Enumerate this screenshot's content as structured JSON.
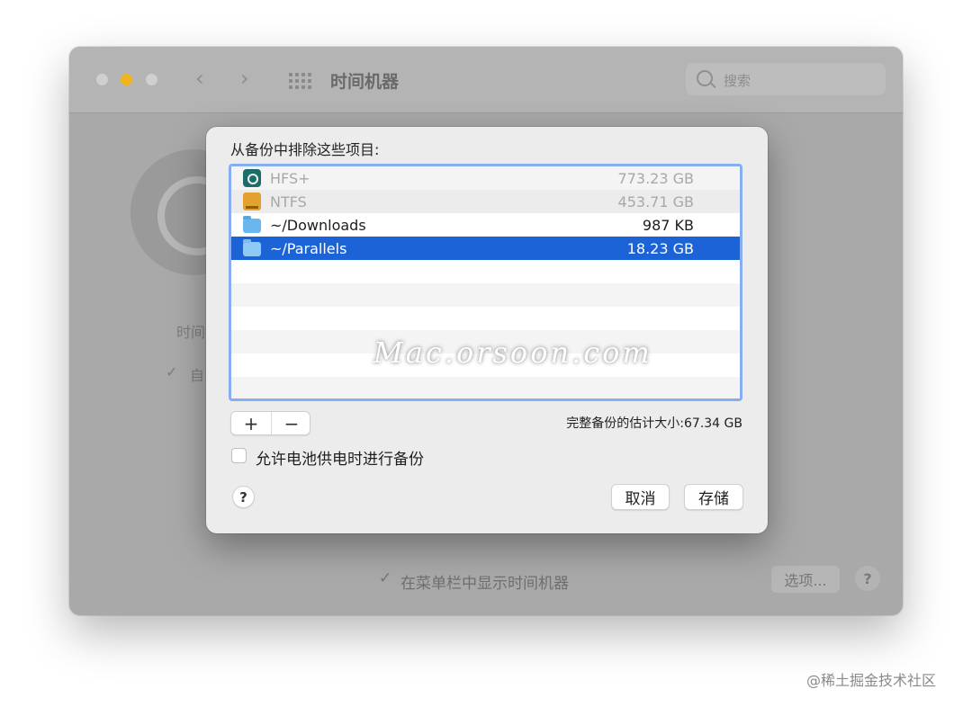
{
  "window": {
    "title": "时间机器",
    "search_placeholder": "搜索",
    "bg_label": "时间",
    "bg_check_mark": "✓",
    "bg_check_label": "自",
    "menubar_check_mark": "✓",
    "menubar_label": "在菜单栏中显示时间机器",
    "options_button": "选项...",
    "help_button": "?"
  },
  "sheet": {
    "heading": "从备份中排除这些项目:",
    "items": [
      {
        "name": "HFS+",
        "size": "773.23 GB",
        "icon": "time-machine-disk-icon",
        "dimmed": true,
        "selected": false
      },
      {
        "name": "NTFS",
        "size": "453.71 GB",
        "icon": "external-drive-icon",
        "dimmed": true,
        "selected": false
      },
      {
        "name": "~/Downloads",
        "size": "987 KB",
        "icon": "downloads-folder-icon",
        "dimmed": false,
        "selected": false
      },
      {
        "name": "~/Parallels",
        "size": "18.23 GB",
        "icon": "folder-icon",
        "dimmed": false,
        "selected": true
      }
    ],
    "add_button": "+",
    "remove_button": "−",
    "estimate_label": "完整备份的估计大小:67.34 GB",
    "battery_checkbox_label": "允许电池供电时进行备份",
    "battery_checked": false,
    "help_button": "?",
    "cancel_button": "取消",
    "save_button": "存储"
  },
  "watermark": "Mac.orsoon.com",
  "corner_watermark": "@稀土掘金技术社区",
  "colors": {
    "selection": "#1b63d6",
    "focus_ring": "#86aef0",
    "traffic_yellow": "#f1b41e"
  }
}
